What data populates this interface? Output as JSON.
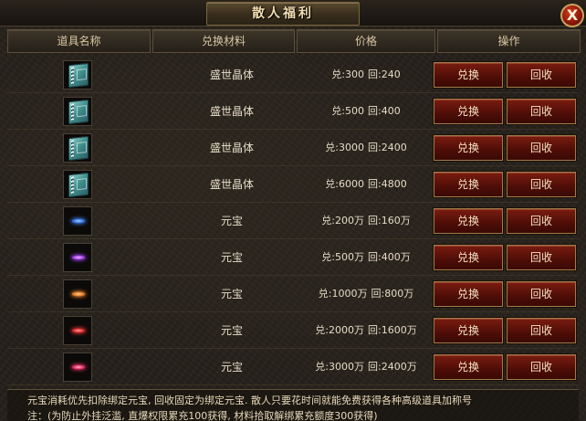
{
  "window": {
    "title": "散人福利",
    "close_label": "X"
  },
  "header": {
    "col_item": "道具名称",
    "col_material": "兑换材料",
    "col_price": "价格",
    "col_action": "操作"
  },
  "rows": [
    {
      "icon": "book-icon",
      "material": "盛世晶体",
      "buy": "兑:300",
      "sell": "回:240",
      "exchange_label": "兑换",
      "recycle_label": "回收"
    },
    {
      "icon": "book-icon",
      "material": "盛世晶体",
      "buy": "兑:500",
      "sell": "回:400",
      "exchange_label": "兑换",
      "recycle_label": "回收"
    },
    {
      "icon": "book-icon",
      "material": "盛世晶体",
      "buy": "兑:3000",
      "sell": "回:2400",
      "exchange_label": "兑换",
      "recycle_label": "回收"
    },
    {
      "icon": "book-icon",
      "material": "盛世晶体",
      "buy": "兑:6000",
      "sell": "回:4800",
      "exchange_label": "兑换",
      "recycle_label": "回收"
    },
    {
      "icon": "title-gem-blue-icon",
      "material": "元宝",
      "buy": "兑:200万",
      "sell": "回:160万",
      "exchange_label": "兑换",
      "recycle_label": "回收"
    },
    {
      "icon": "title-gem-purple-icon",
      "material": "元宝",
      "buy": "兑:500万",
      "sell": "回:400万",
      "exchange_label": "兑换",
      "recycle_label": "回收"
    },
    {
      "icon": "title-gem-orange-icon",
      "material": "元宝",
      "buy": "兑:1000万",
      "sell": "回:800万",
      "exchange_label": "兑换",
      "recycle_label": "回收"
    },
    {
      "icon": "title-gem-red-icon",
      "material": "元宝",
      "buy": "兑:2000万",
      "sell": "回:1600万",
      "exchange_label": "兑换",
      "recycle_label": "回收"
    },
    {
      "icon": "title-gem-pink-icon",
      "material": "元宝",
      "buy": "兑:3000万",
      "sell": "回:2400万",
      "exchange_label": "兑换",
      "recycle_label": "回收"
    }
  ],
  "footer": {
    "line1": "元宝消耗优先扣除绑定元宝, 回收固定为绑定元宝. 散人只要花时间就能免费获得各种高级道具加称号",
    "line2": "注：(为防止外挂泛滥, 直爆权限累充100获得, 材料拾取解绑累充额度300获得)"
  },
  "colors": {
    "accent": "#c9a260",
    "button": "#5e120a",
    "text": "#e6dcc6"
  }
}
